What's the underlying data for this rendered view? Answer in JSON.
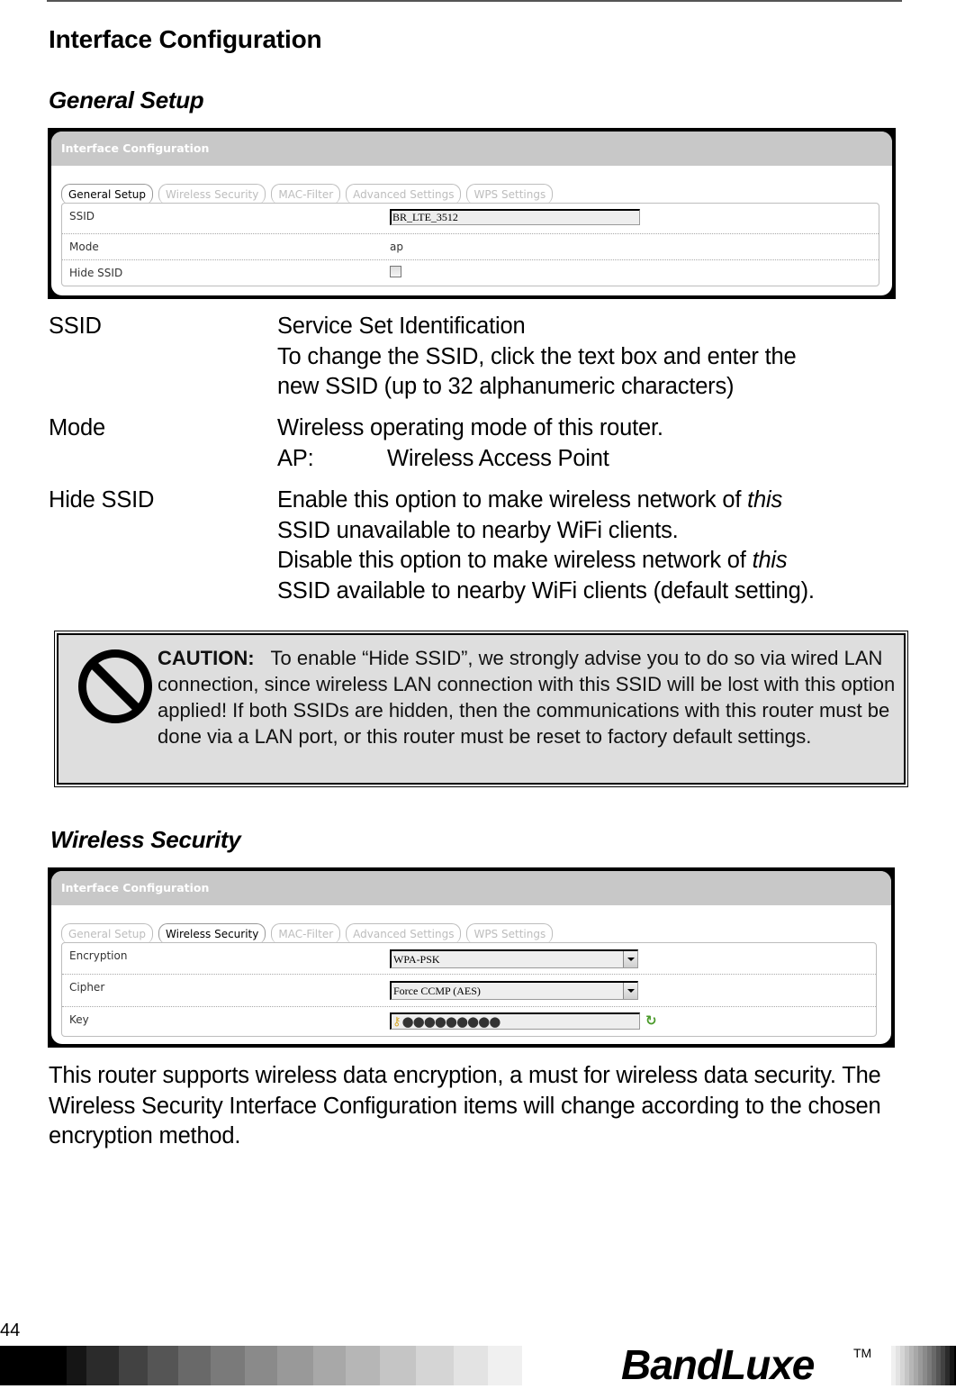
{
  "page": {
    "heading": "Interface Configuration",
    "page_number": "44",
    "brand": "BandLuxe",
    "trademark": "TM"
  },
  "general_setup": {
    "section_title": "General Setup",
    "panel": {
      "header": "Interface Configuration",
      "tabs": [
        {
          "label": "General Setup",
          "active": true
        },
        {
          "label": "Wireless Security",
          "active": false
        },
        {
          "label": "MAC-Filter",
          "active": false
        },
        {
          "label": "Advanced Settings",
          "active": false
        },
        {
          "label": "WPS Settings",
          "active": false
        }
      ],
      "rows": [
        {
          "label": "SSID",
          "value": "BR_LTE_3512",
          "type": "text"
        },
        {
          "label": "Mode",
          "value": "ap",
          "type": "static"
        },
        {
          "label": "Hide SSID",
          "value": false,
          "type": "checkbox"
        }
      ]
    },
    "descriptions": [
      {
        "term": "SSID",
        "lines": [
          "Service Set Identification",
          "To change the SSID, click the text box and enter the",
          "new SSID (up to 32 alphanumeric characters)"
        ]
      },
      {
        "term": "Mode",
        "lines": [
          "Wireless operating mode of this router."
        ],
        "sub": {
          "key": "AP:",
          "value": "Wireless Access Point"
        }
      },
      {
        "term": "Hide SSID",
        "lines": [
          "Enable this option to make wireless network of ",
          "SSID unavailable to nearby WiFi clients.",
          "Disable this option to make wireless network of ",
          "SSID available to nearby WiFi clients (default setting)."
        ],
        "emphasis": "this"
      }
    ],
    "caution": {
      "label": "CAUTION:",
      "text": "To enable “Hide SSID”, we strongly advise you to do so via wired LAN connection, since wireless LAN connection with this SSID will be lost with this option applied! If both SSIDs are hidden, then the communications with this router must be done via a LAN port, or this router must be reset to factory default settings.",
      "icon": "no-entry-icon"
    }
  },
  "wireless_security": {
    "section_title": "Wireless Security",
    "panel": {
      "header": "Interface Configuration",
      "tabs": [
        {
          "label": "General Setup",
          "active": false
        },
        {
          "label": "Wireless Security",
          "active": true
        },
        {
          "label": "MAC-Filter",
          "active": false
        },
        {
          "label": "Advanced Settings",
          "active": false
        },
        {
          "label": "WPS Settings",
          "active": false
        }
      ],
      "rows": [
        {
          "label": "Encryption",
          "value": "WPA-PSK",
          "type": "select"
        },
        {
          "label": "Cipher",
          "value": "Force CCMP (AES)",
          "type": "select"
        },
        {
          "label": "Key",
          "value": "●●●●●●●●●",
          "type": "password"
        }
      ]
    },
    "paragraph": "This router supports wireless data encryption, a must for wireless data security. The Wireless Security Interface Configuration items will change according to the chosen encryption method."
  },
  "colors": {
    "panel_header_bg": "#c8c8c8",
    "caution_bg": "#dedede",
    "tab_inactive_text": "#bdbdbd"
  }
}
